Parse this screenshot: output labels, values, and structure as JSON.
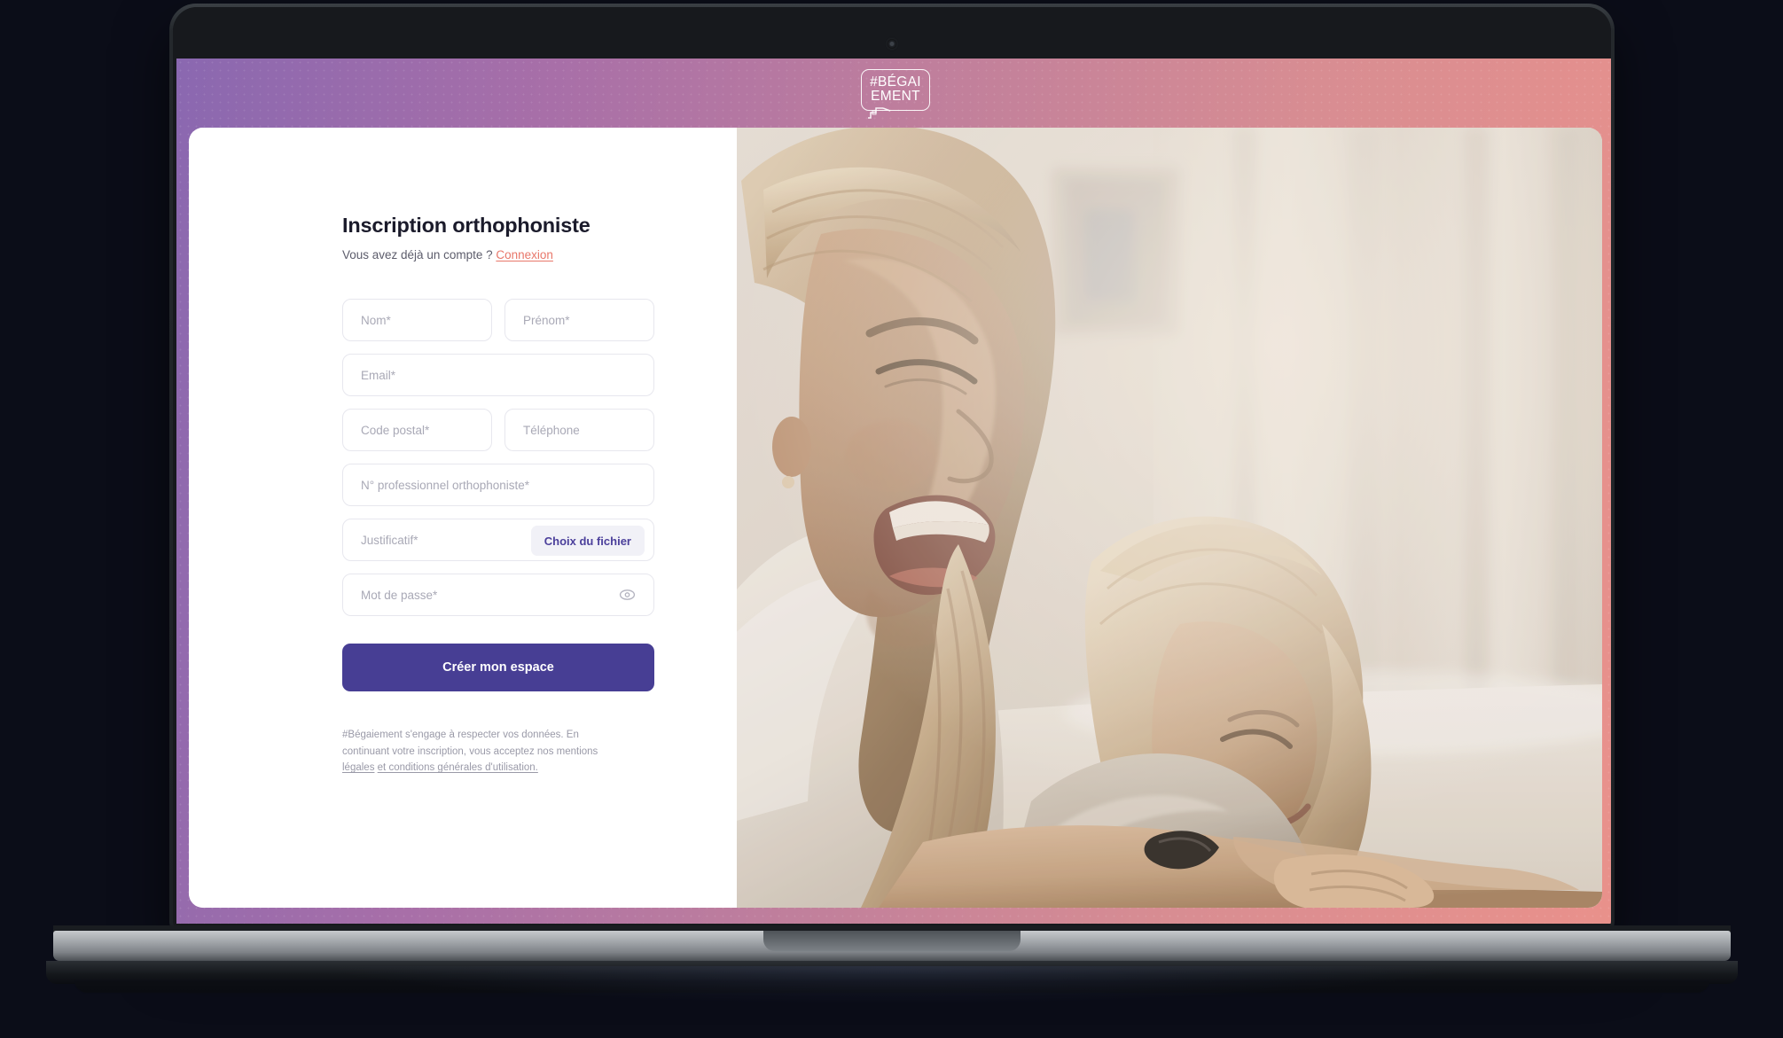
{
  "device": {
    "type": "laptop-mockup",
    "camera_icon": "camera-dot"
  },
  "site": {
    "header": {
      "logo": {
        "line1": "#BÉGAI",
        "line2": "EMENT",
        "alt": "#Bégaiement",
        "icon": "speech-bubble-logo"
      },
      "gradient_from": "#8a68b0",
      "gradient_to": "#e9918b"
    },
    "form": {
      "title": "Inscription orthophoniste",
      "account_prompt": "Vous avez déjà un compte ?",
      "login_link": "Connexion",
      "fields": [
        {
          "name": "nom",
          "placeholder": "Nom*",
          "value": ""
        },
        {
          "name": "prenom",
          "placeholder": "Prénom*",
          "value": ""
        },
        {
          "name": "email",
          "placeholder": "Email*",
          "value": ""
        },
        {
          "name": "code-postal",
          "placeholder": "Code postal*",
          "value": ""
        },
        {
          "name": "telephone",
          "placeholder": "Téléphone",
          "value": ""
        },
        {
          "name": "numero-professionnel",
          "placeholder": "N° professionnel orthophoniste*",
          "value": ""
        },
        {
          "name": "justificatif",
          "placeholder": "Justificatif*",
          "value": ""
        },
        {
          "name": "mot-de-passe",
          "placeholder": "Mot de passe*",
          "value": ""
        }
      ],
      "file_button": "Choix du fichier",
      "password_toggle_icon": "eye-icon",
      "submit": "Créer mon espace",
      "legal_part1": "#Bégaiement s'engage à respecter vos données. En continuant votre inscription, vous acceptez nos mentions ",
      "legal_link1": "légales",
      "legal_mid": " ",
      "legal_link2": "et conditions générales d'utilisation.",
      "colors": {
        "primary": "#473e94",
        "accent": "#e8776a",
        "title": "#1b1b2b",
        "placeholder": "#a9a9b6",
        "border": "#e7e7ee",
        "file_button_bg": "#f1f1f7"
      }
    },
    "photo": {
      "alt": "Femme riant avec une petite fille allongées sur un lit",
      "tone": "sepia"
    }
  }
}
